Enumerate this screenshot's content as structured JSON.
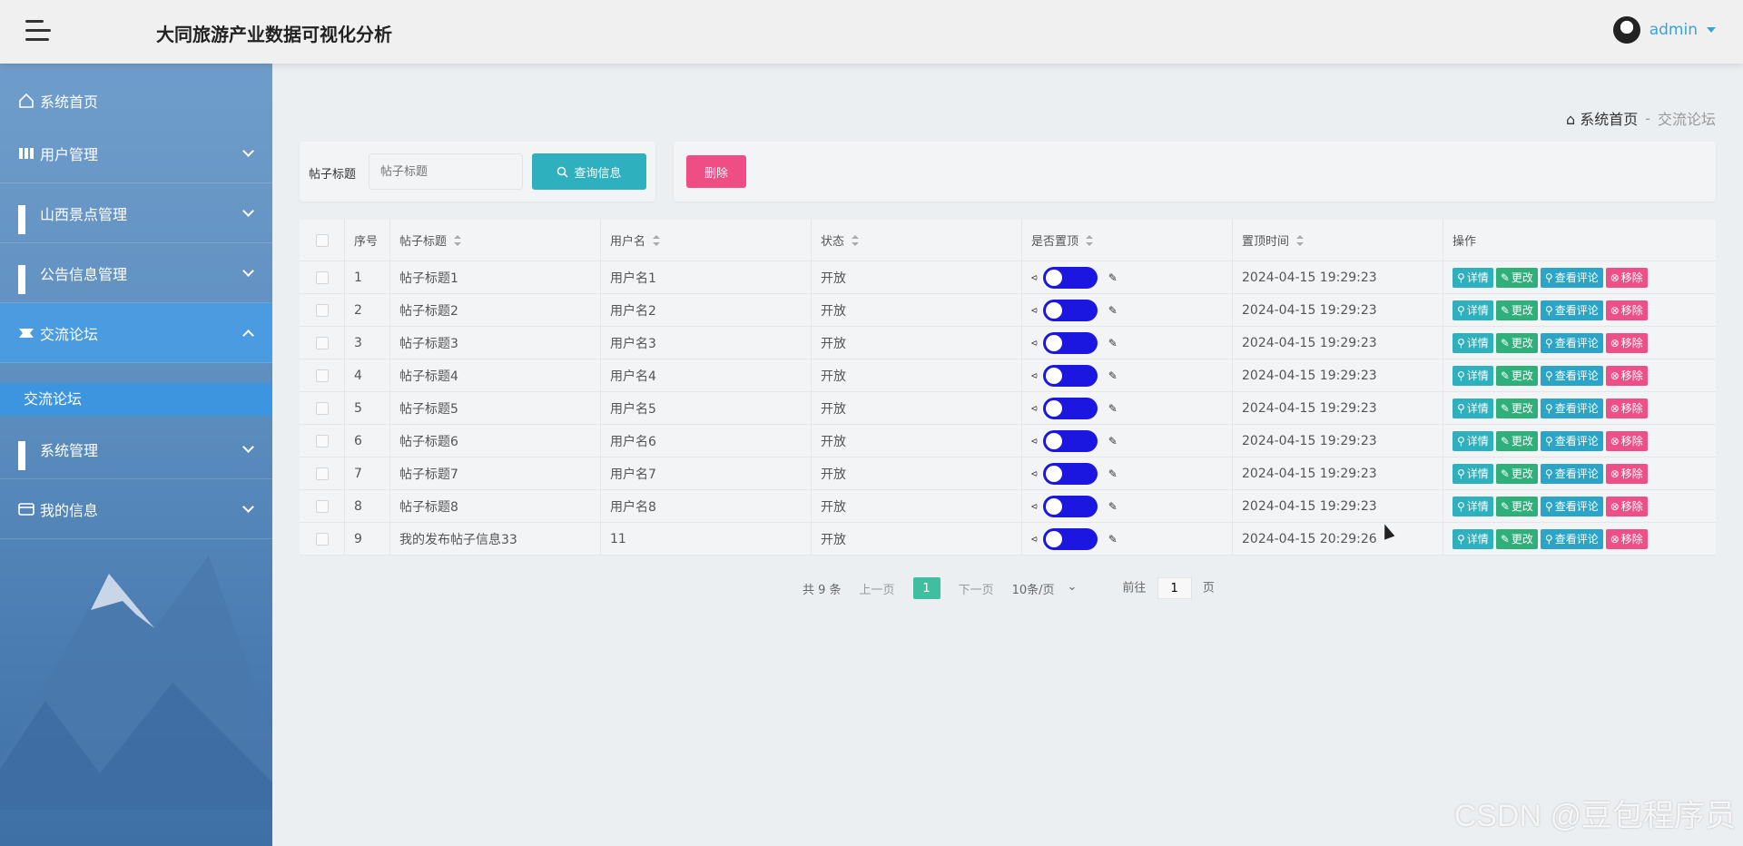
{
  "header": {
    "title": "大同旅游产业数据可视化分析",
    "username": "admin"
  },
  "sidebar": {
    "items": [
      {
        "label": "系统首页"
      },
      {
        "label": "用户管理"
      },
      {
        "label": "山西景点管理"
      },
      {
        "label": "公告信息管理"
      },
      {
        "label": "交流论坛"
      },
      {
        "label": "系统管理"
      },
      {
        "label": "我的信息"
      }
    ],
    "sub_active": "交流论坛"
  },
  "breadcrumb": {
    "home": "系统首页",
    "sep": "-",
    "current": "交流论坛"
  },
  "search": {
    "label": "帖子标题",
    "placeholder": "帖子标题",
    "button": "查询信息",
    "delete": "删除"
  },
  "table": {
    "headers": [
      "序号",
      "帖子标题",
      "用户名",
      "状态",
      "是否置顶",
      "置顶时间",
      "操作"
    ],
    "actions": [
      "详情",
      "更改",
      "查看评论",
      "移除"
    ],
    "rows": [
      {
        "no": "1",
        "title": "帖子标题1",
        "user": "用户名1",
        "status": "开放",
        "time": "2024-04-15 19:29:23"
      },
      {
        "no": "2",
        "title": "帖子标题2",
        "user": "用户名2",
        "status": "开放",
        "time": "2024-04-15 19:29:23"
      },
      {
        "no": "3",
        "title": "帖子标题3",
        "user": "用户名3",
        "status": "开放",
        "time": "2024-04-15 19:29:23"
      },
      {
        "no": "4",
        "title": "帖子标题4",
        "user": "用户名4",
        "status": "开放",
        "time": "2024-04-15 19:29:23"
      },
      {
        "no": "5",
        "title": "帖子标题5",
        "user": "用户名5",
        "status": "开放",
        "time": "2024-04-15 19:29:23"
      },
      {
        "no": "6",
        "title": "帖子标题6",
        "user": "用户名6",
        "status": "开放",
        "time": "2024-04-15 19:29:23"
      },
      {
        "no": "7",
        "title": "帖子标题7",
        "user": "用户名7",
        "status": "开放",
        "time": "2024-04-15 19:29:23"
      },
      {
        "no": "8",
        "title": "帖子标题8",
        "user": "用户名8",
        "status": "开放",
        "time": "2024-04-15 19:29:23"
      },
      {
        "no": "9",
        "title": "我的发布帖子信息33",
        "user": "11",
        "status": "开放",
        "time": "2024-04-15 20:29:26"
      }
    ]
  },
  "pagination": {
    "total": "共 9 条",
    "prev": "上一页",
    "page": "1",
    "next": "下一页",
    "size": "10条/页",
    "goto_prefix": "前往",
    "goto_value": "1",
    "goto_suffix": "页"
  },
  "watermark": "CSDN @豆包程序员"
}
